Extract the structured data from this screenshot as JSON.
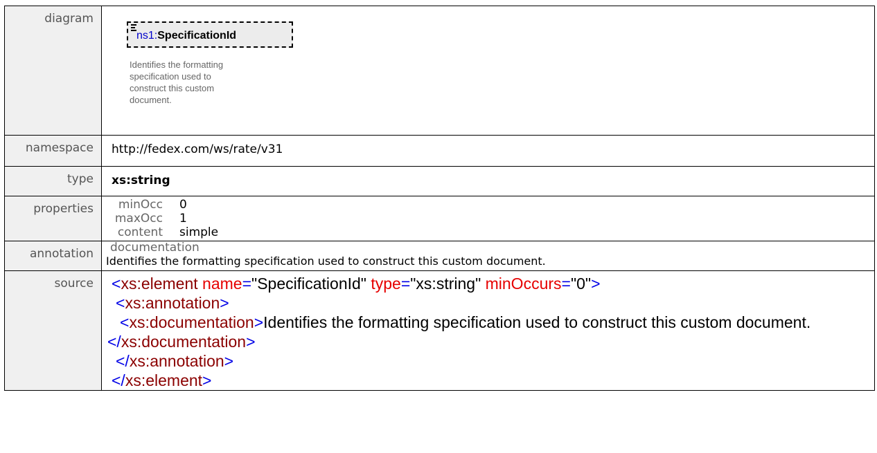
{
  "labels": {
    "diagram": "diagram",
    "namespace": "namespace",
    "type": "type",
    "properties": "properties",
    "annotation": "annotation",
    "source": "source"
  },
  "diagram": {
    "prefix": "ns1:",
    "element_name": "SpecificationId",
    "doc_lines": [
      "Identifies the formatting",
      "specification used to",
      "construct this custom",
      "document."
    ]
  },
  "namespace": "http://fedex.com/ws/rate/v31",
  "type": "xs:string",
  "properties": [
    {
      "key": "minOcc",
      "value": "0"
    },
    {
      "key": "maxOcc",
      "value": "1"
    },
    {
      "key": "content",
      "value": "simple"
    }
  ],
  "annotation": {
    "heading": "documentation",
    "text": "Identifies the formatting specification used to construct this custom document."
  },
  "source": {
    "open_lt": "<",
    "close_gt": ">",
    "end_lt": "</",
    "element_tag": "xs:element",
    "attr_name": "name",
    "attr_name_val": "\"SpecificationId\"",
    "attr_type": "type",
    "attr_type_val": "\"xs:string\"",
    "attr_min": "minOccurs",
    "attr_min_val": "\"0\"",
    "eq": "=",
    "annotation_tag": "xs:annotation",
    "documentation_tag": "xs:documentation",
    "doc_text": "Identifies the formatting specification used to construct this custom document."
  }
}
